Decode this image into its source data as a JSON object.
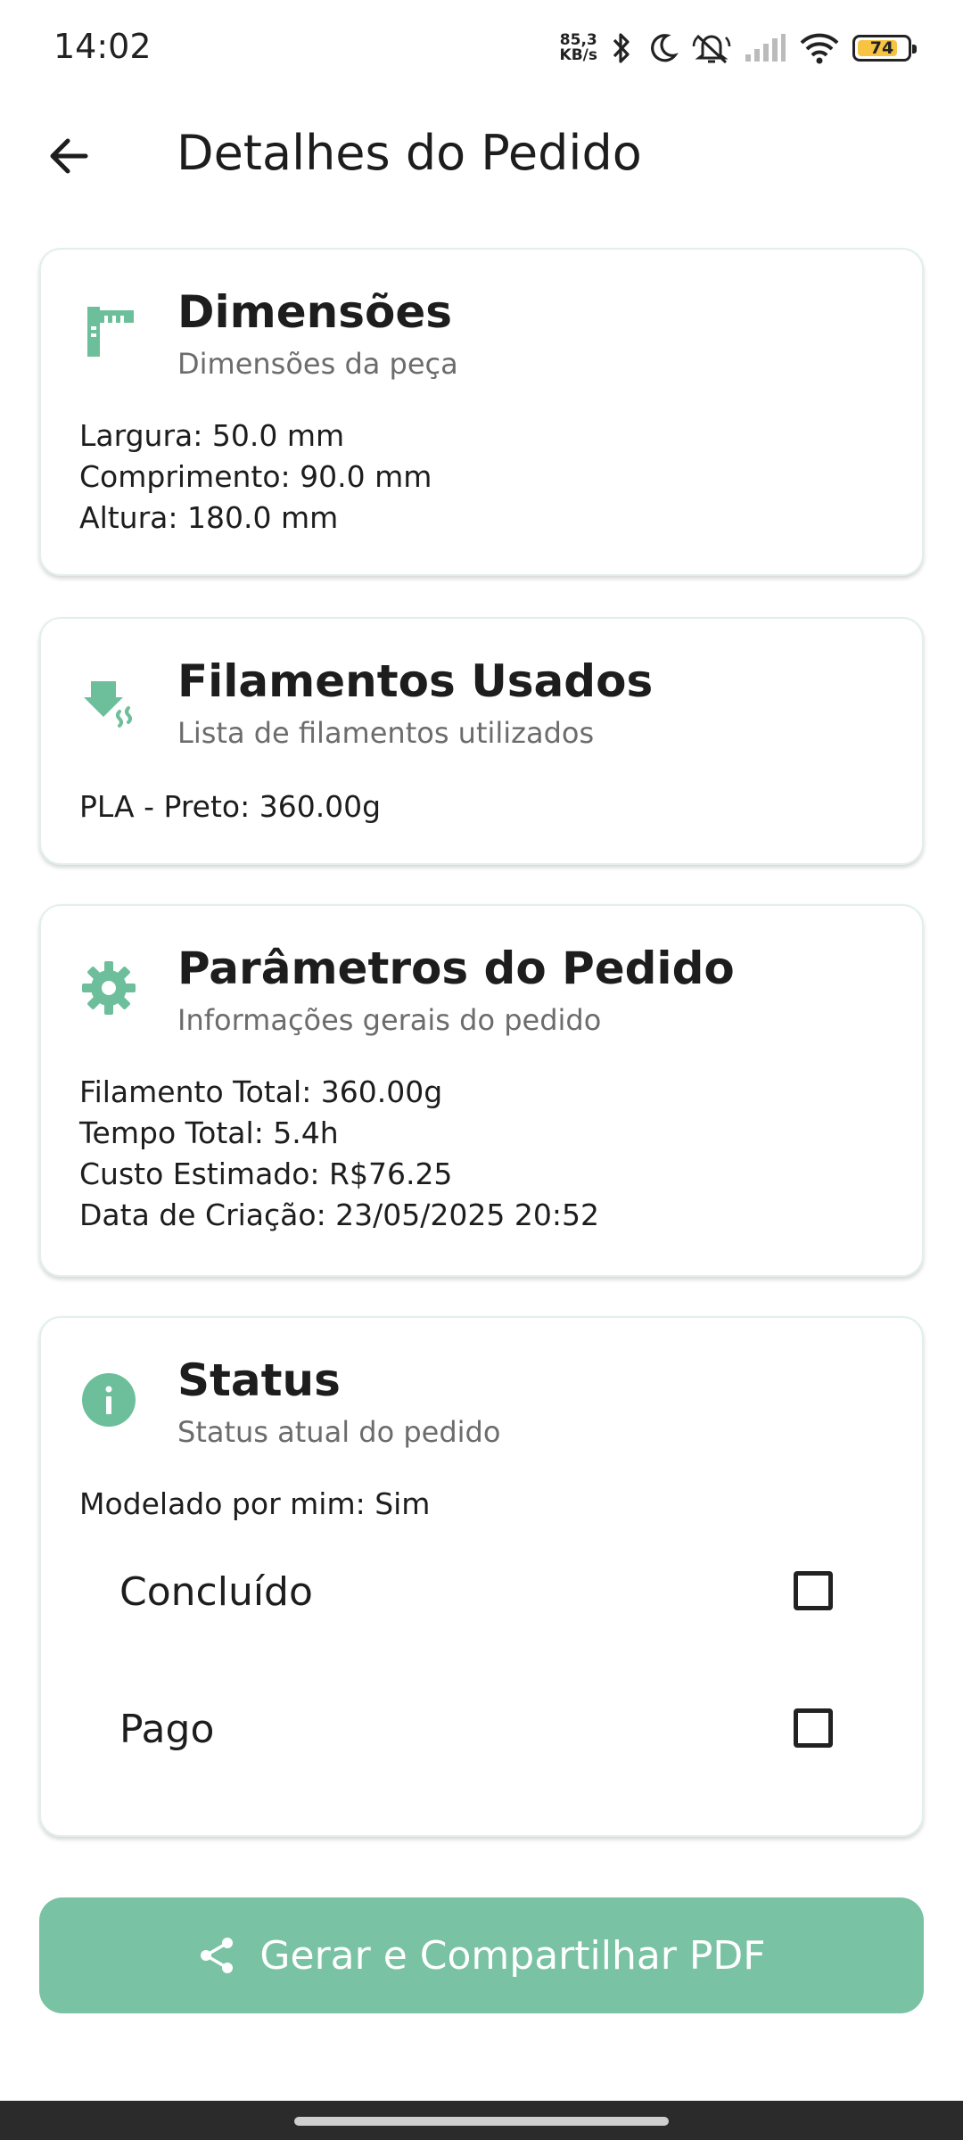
{
  "status_bar": {
    "time": "14:02",
    "net_speed_value": "85,3",
    "net_speed_unit": "KB/s",
    "battery_level": "74",
    "icons": [
      "bluetooth-icon",
      "moon-icon",
      "mute-icon",
      "signal-icon",
      "wifi-icon",
      "battery-icon"
    ]
  },
  "app_bar": {
    "title": "Detalhes do Pedido",
    "back_icon": "arrow-back-icon"
  },
  "cards": {
    "dimensions": {
      "icon": "ruler-icon",
      "title": "Dimensões",
      "subtitle": "Dimensões da peça",
      "lines": [
        "Largura: 50.0 mm",
        "Comprimento: 90.0 mm",
        "Altura: 180.0 mm"
      ]
    },
    "filaments": {
      "icon": "filament-icon",
      "title": "Filamentos Usados",
      "subtitle": "Lista de filamentos utilizados",
      "lines": [
        "PLA - Preto: 360.00g"
      ]
    },
    "parameters": {
      "icon": "gear-icon",
      "title": "Parâmetros do Pedido",
      "subtitle": "Informações gerais do pedido",
      "lines": [
        "Filamento Total: 360.00g",
        "Tempo Total: 5.4h",
        "Custo Estimado: R$76.25",
        "Data de Criação: 23/05/2025 20:52"
      ]
    },
    "status": {
      "icon": "info-icon",
      "title": "Status",
      "subtitle": "Status atual do pedido",
      "lines": [
        "Modelado por mim: Sim"
      ],
      "checkboxes": [
        {
          "label": "Concluído",
          "checked": false
        },
        {
          "label": "Pago",
          "checked": false
        }
      ]
    }
  },
  "pdf_button": {
    "label": "Gerar e Compartilhar PDF",
    "icon": "share-icon"
  },
  "colors": {
    "accent": "#79c2a3",
    "icon_green": "#6dbf9b",
    "text": "#1d1d1d",
    "subtext": "#6c6c6c"
  }
}
